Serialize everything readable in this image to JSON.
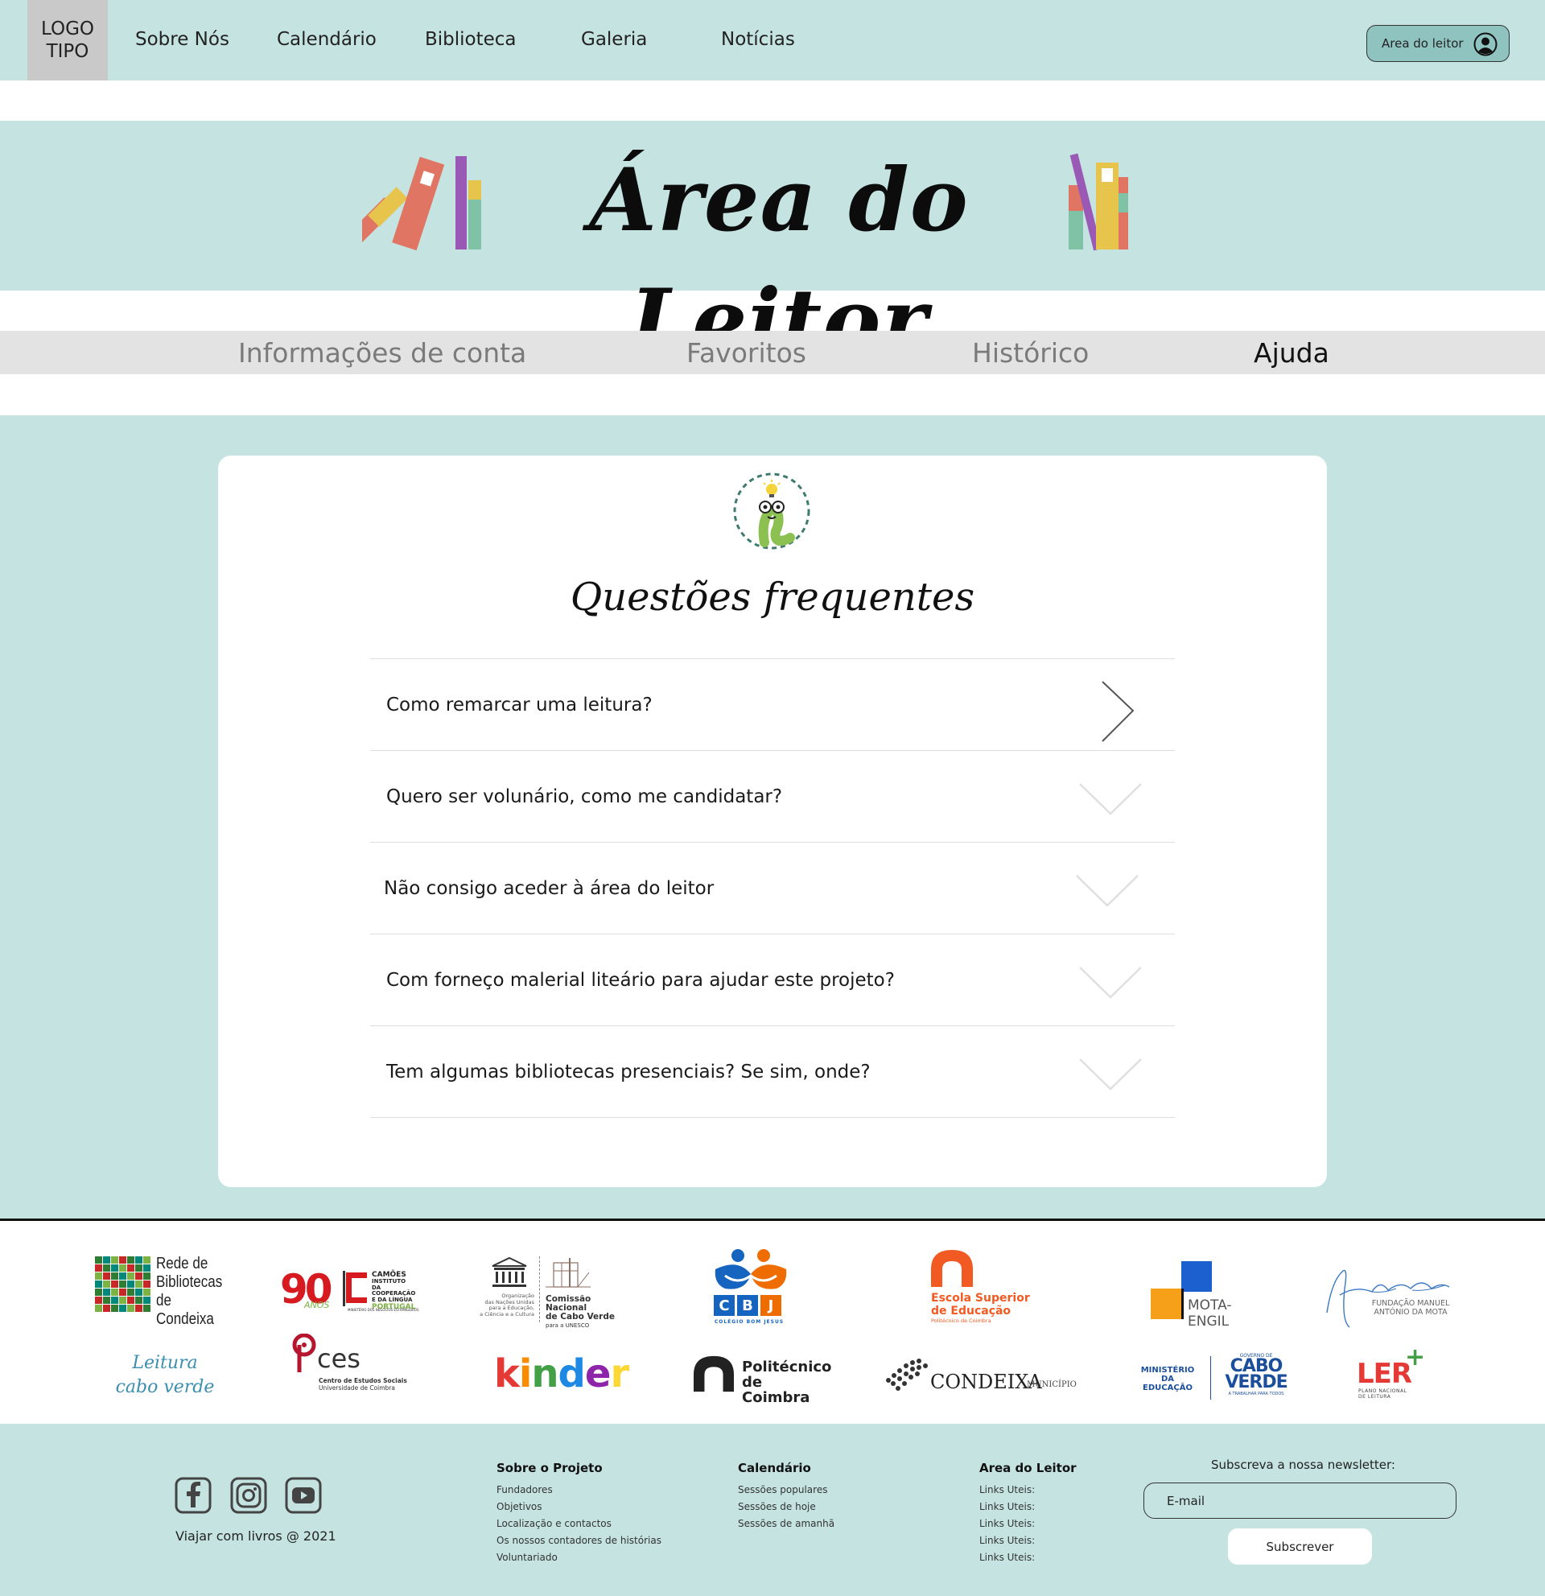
{
  "nav": {
    "logo_line1": "LOGO",
    "logo_line2": "TIPO",
    "links": [
      "Sobre Nós",
      "Calendário",
      "Biblioteca",
      "Galeria",
      "Notícias"
    ],
    "reader_button": "Area do leitor"
  },
  "hero": {
    "title": "Área do Leitor"
  },
  "tabs": [
    {
      "label": "Informações de conta",
      "active": false
    },
    {
      "label": "Favoritos",
      "active": false
    },
    {
      "label": "Histórico",
      "active": false
    },
    {
      "label": "Ajuda",
      "active": true
    }
  ],
  "faq": {
    "title": "Questões frequentes",
    "items": [
      {
        "question": "Como remarcar uma leitura?",
        "state": "selected"
      },
      {
        "question": "Quero ser volunário, como me candidatar?",
        "state": "collapsed"
      },
      {
        "question": "Não consigo aceder à área do leitor",
        "state": "collapsed"
      },
      {
        "question": "Com forneço malerial liteário para ajudar este projeto?",
        "state": "collapsed"
      },
      {
        "question": "Tem algumas bibliotecas presenciais? Se sim, onde?",
        "state": "collapsed"
      }
    ]
  },
  "partners": {
    "rede": [
      "Rede de",
      "Bibliotecas",
      "de Condeixa"
    ],
    "camoes": {
      "number": "90",
      "anos": "ANOS",
      "name": "CAMÕES",
      "line2": "INSTITUTO",
      "line3": "DA COOPERAÇÃO",
      "line4": "E DA LÍNGUA",
      "country": "PORTUGAL",
      "ministry": "MINISTÉRIO DOS NEGÓCIOS ESTRANGEIROS"
    },
    "unesco": {
      "mark": "UNESCO",
      "org1": "Organização",
      "org2": "das Nações Unidas",
      "org3": "para a Educação,",
      "org4": "a Ciência e a Cultura",
      "com1": "Comissão Nacional",
      "com2": "de Cabo Verde",
      "com3": "para a UNESCO"
    },
    "cbj": {
      "letters": [
        "C",
        "B",
        "J"
      ],
      "name": "COLÉGIO BOM JESUS"
    },
    "ese": {
      "line1": "Escola Superior",
      "line2": "de Educação",
      "line3": "Politécnico de Coimbra"
    },
    "mota": "MOTA-ENGIL",
    "fundacao": [
      "FUNDAÇÃO MANUEL",
      "ANTÓNIO DA MOTA"
    ],
    "leitura": [
      "Leitura",
      "cabo verde"
    ],
    "ces": {
      "name": "ces",
      "line1": "Centro de Estudos Sociais",
      "line2": "Universidade de Coimbra"
    },
    "kinder": "kinder",
    "politecnico": [
      "Politécnico",
      "de Coimbra"
    ],
    "condeixa": {
      "name": "CONDEIXA",
      "sub": "MUNICÍPIO"
    },
    "cabo_verde": {
      "ministry1": "MINISTÉRIO DA",
      "ministry2": "EDUCAÇÃO",
      "gov": "GOVERNO DE",
      "cabo": "CABO",
      "verde": "VERDE",
      "tag": "A TRABALHAR PARA TODOS"
    },
    "ler": {
      "name": "LER",
      "line1": "PLANO NACIONAL",
      "line2": "DE LEITURA"
    }
  },
  "footer": {
    "copyright": "Viajar com livros @ 2021",
    "columns": [
      {
        "title": "Sobre o Projeto",
        "links": [
          "Fundadores",
          "Objetivos",
          "Localização e contactos",
          "Os nossos contadores de histórias",
          "Voluntariado"
        ]
      },
      {
        "title": "Calendário",
        "links": [
          "Sessões populares",
          "Sessões de hoje",
          "Sessões de amanhã"
        ]
      },
      {
        "title": "Area do Leitor",
        "links": [
          "Links Uteis:",
          "Links Uteis:",
          "Links Uteis:",
          "Links Uteis:",
          "Links Uteis:"
        ]
      }
    ],
    "newsletter_label": "Subscreva a nossa newsletter:",
    "email_placeholder": "E-mail",
    "subscribe_button": "Subscrever"
  },
  "colors": {
    "mint": "#c5e4e1",
    "tab_bar": "#e3e3e3",
    "reader_button": "#8fc3c0"
  },
  "icons": [
    "user-icon",
    "chevron-right-icon",
    "chevron-down-icon",
    "facebook-icon",
    "instagram-icon",
    "youtube-icon"
  ]
}
